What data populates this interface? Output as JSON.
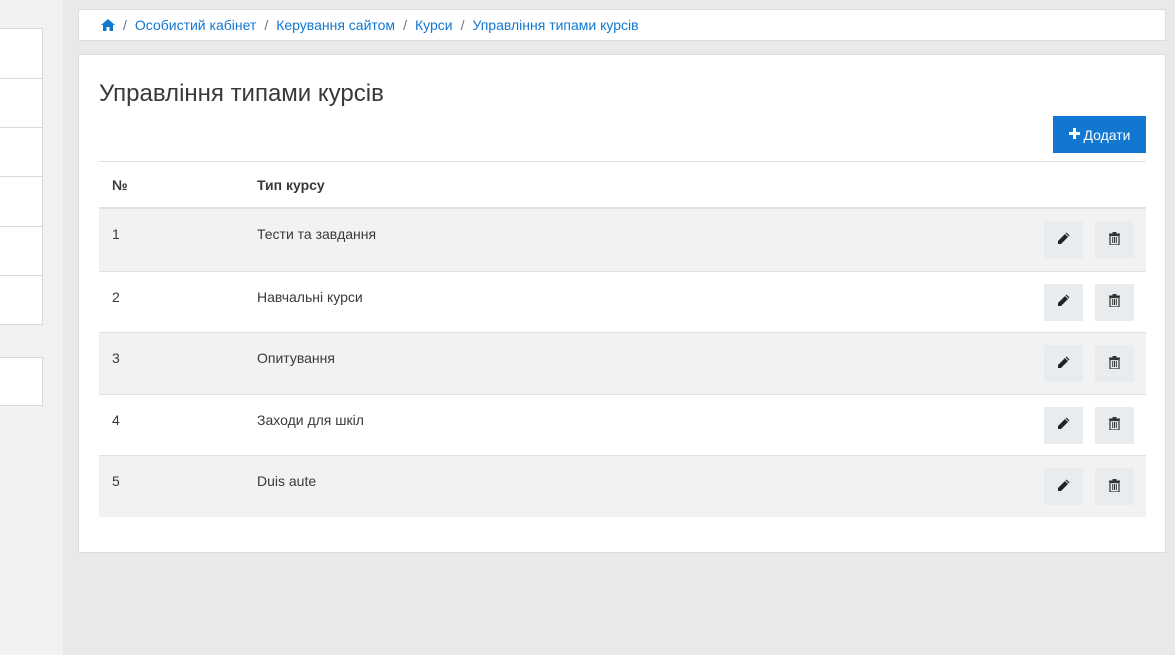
{
  "breadcrumb": {
    "home_icon": "home-icon",
    "items": [
      "Особистий кабінет",
      "Керування сайтом",
      "Курси",
      "Управління типами курсів"
    ],
    "separator": "/"
  },
  "page": {
    "title": "Управління типами курсів",
    "add_button_label": "Додати"
  },
  "table": {
    "headers": [
      "№",
      "Тип курсу"
    ],
    "rows": [
      {
        "num": "1",
        "type": "Тести та завдання"
      },
      {
        "num": "2",
        "type": "Навчальні курси"
      },
      {
        "num": "3",
        "type": "Опитування"
      },
      {
        "num": "4",
        "type": "Заходи для шкіл"
      },
      {
        "num": "5",
        "type": "Duis aute"
      }
    ],
    "row_actions": [
      "pencil-icon",
      "trash-icon"
    ]
  },
  "colors": {
    "accent": "#1177d1",
    "background": "#e9e9e9",
    "stripe": "#f2f2f2"
  }
}
